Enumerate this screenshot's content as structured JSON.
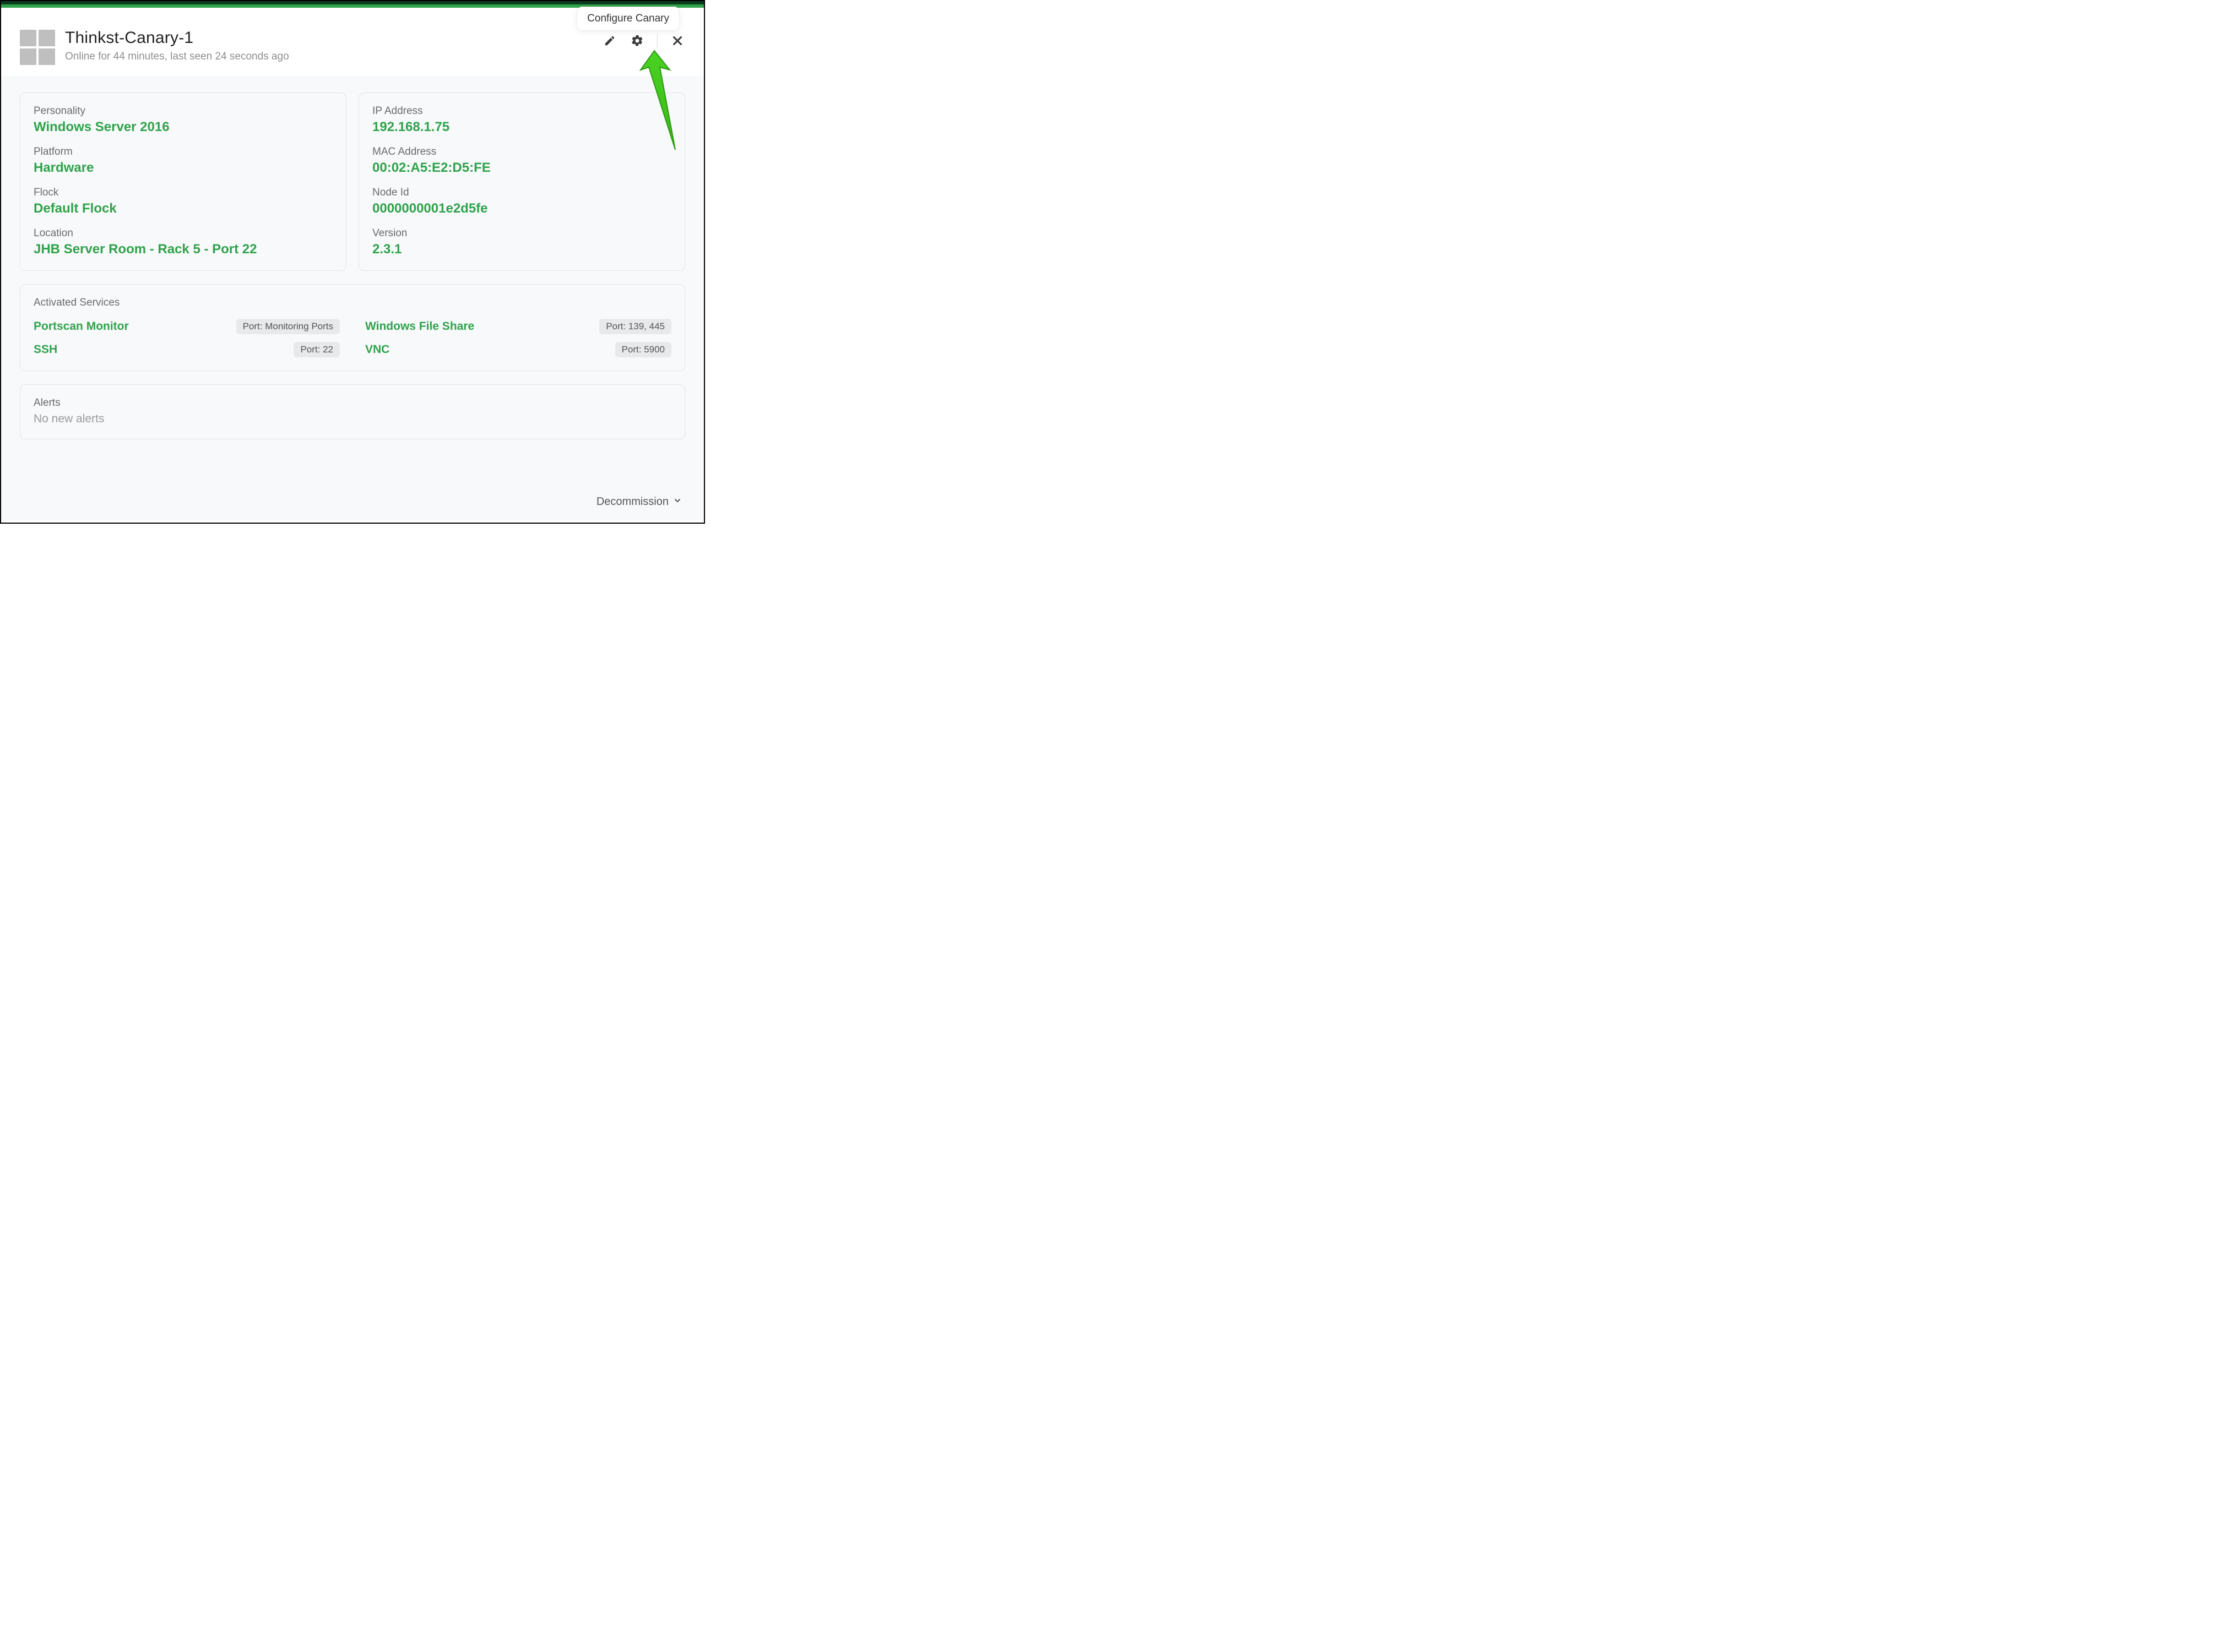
{
  "tooltip": "Configure Canary",
  "header": {
    "title": "Thinkst-Canary-1",
    "subtitle": "Online for 44 minutes, last seen 24 seconds ago"
  },
  "details": {
    "left": [
      {
        "label": "Personality",
        "value": "Windows Server 2016"
      },
      {
        "label": "Platform",
        "value": "Hardware"
      },
      {
        "label": "Flock",
        "value": "Default Flock"
      },
      {
        "label": "Location",
        "value": "JHB Server Room - Rack 5 - Port 22"
      }
    ],
    "right": [
      {
        "label": "IP Address",
        "value": "192.168.1.75"
      },
      {
        "label": "MAC Address",
        "value": "00:02:A5:E2:D5:FE"
      },
      {
        "label": "Node Id",
        "value": "0000000001e2d5fe"
      },
      {
        "label": "Version",
        "value": "2.3.1"
      }
    ]
  },
  "services": {
    "title": "Activated Services",
    "items": [
      {
        "name": "Portscan Monitor",
        "port": "Port: Monitoring Ports"
      },
      {
        "name": "Windows File Share",
        "port": "Port: 139, 445"
      },
      {
        "name": "SSH",
        "port": "Port: 22"
      },
      {
        "name": "VNC",
        "port": "Port: 5900"
      }
    ]
  },
  "alerts": {
    "title": "Alerts",
    "body": "No new alerts"
  },
  "footer": {
    "decommission": "Decommission"
  }
}
